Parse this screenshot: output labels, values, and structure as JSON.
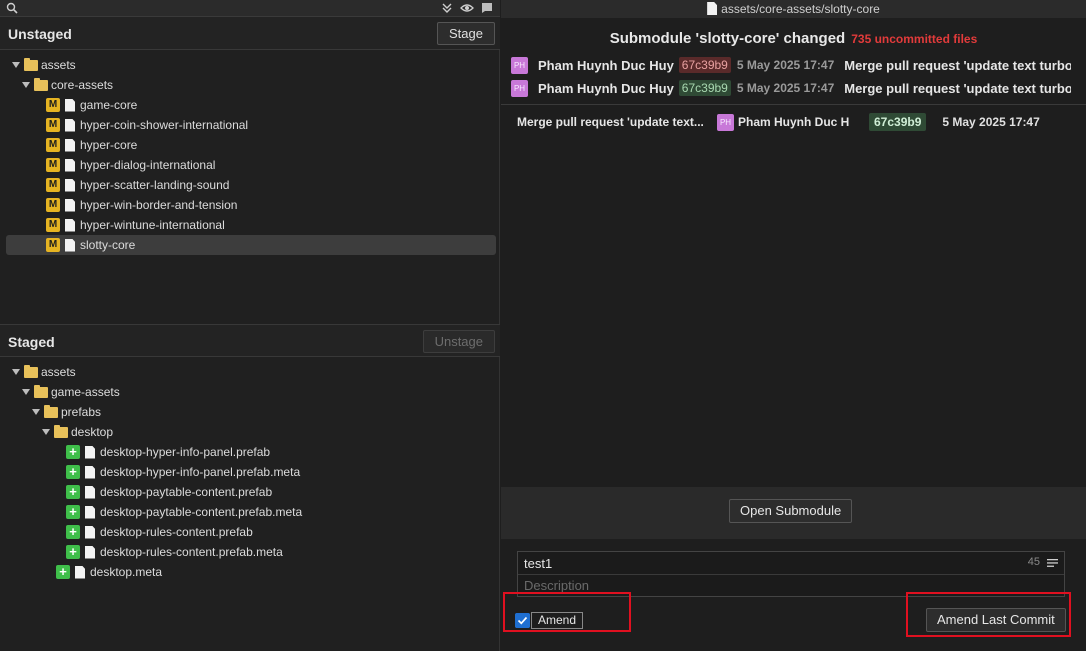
{
  "toolbar": {
    "icons": [
      "search-icon",
      "collapse-all-icon",
      "eye-icon",
      "comment-icon"
    ]
  },
  "unstaged": {
    "title": "Unstaged",
    "button": "Stage",
    "tree": [
      {
        "label": "assets",
        "kind": "folder",
        "depth": 0
      },
      {
        "label": "core-assets",
        "kind": "folder",
        "depth": 1
      },
      {
        "label": "game-core",
        "kind": "file",
        "status": "M",
        "depth": 2
      },
      {
        "label": "hyper-coin-shower-international",
        "kind": "file",
        "status": "M",
        "depth": 2
      },
      {
        "label": "hyper-core",
        "kind": "file",
        "status": "M",
        "depth": 2
      },
      {
        "label": "hyper-dialog-international",
        "kind": "file",
        "status": "M",
        "depth": 2
      },
      {
        "label": "hyper-scatter-landing-sound",
        "kind": "file",
        "status": "M",
        "depth": 2
      },
      {
        "label": "hyper-win-border-and-tension",
        "kind": "file",
        "status": "M",
        "depth": 2
      },
      {
        "label": "hyper-wintune-international",
        "kind": "file",
        "status": "M",
        "depth": 2
      },
      {
        "label": "slotty-core",
        "kind": "file",
        "status": "M",
        "depth": 2,
        "selected": true
      }
    ]
  },
  "staged": {
    "title": "Staged",
    "button": "Unstage",
    "tree": [
      {
        "label": "assets",
        "kind": "folder",
        "depth": 0
      },
      {
        "label": "game-assets",
        "kind": "folder",
        "depth": 1
      },
      {
        "label": "prefabs",
        "kind": "folder",
        "depth": 2
      },
      {
        "label": "desktop",
        "kind": "folder",
        "depth": 3
      },
      {
        "label": "desktop-hyper-info-panel.prefab",
        "kind": "file",
        "status": "+",
        "depth": 4
      },
      {
        "label": "desktop-hyper-info-panel.prefab.meta",
        "kind": "file",
        "status": "+",
        "depth": 4
      },
      {
        "label": "desktop-paytable-content.prefab",
        "kind": "file",
        "status": "+",
        "depth": 4
      },
      {
        "label": "desktop-paytable-content.prefab.meta",
        "kind": "file",
        "status": "+",
        "depth": 4
      },
      {
        "label": "desktop-rules-content.prefab",
        "kind": "file",
        "status": "+",
        "depth": 4
      },
      {
        "label": "desktop-rules-content.prefab.meta",
        "kind": "file",
        "status": "+",
        "depth": 4
      },
      {
        "label": "desktop.meta",
        "kind": "file",
        "status": "+",
        "depth": 3
      }
    ]
  },
  "diff": {
    "path": "assets/core-assets/slotty-core",
    "title": "Submodule 'slotty-core' changed",
    "uncommitted": "735 uncommitted files",
    "commits": [
      {
        "avatar": "PH",
        "author": "Pham Huynh Duc Huy",
        "sha": "67c39b9",
        "sha_style": "red",
        "date": "5 May 2025 17:47",
        "message": "Merge pull request 'update text turbo"
      },
      {
        "avatar": "PH",
        "author": "Pham Huynh Duc Huy",
        "sha": "67c39b9",
        "sha_style": "green",
        "date": "5 May 2025 17:47",
        "message": "Merge pull request 'update text turbo"
      }
    ],
    "detail": {
      "message": "Merge pull request 'update text...",
      "avatar": "PH",
      "author": "Pham Huynh Duc H",
      "sha": "67c39b9",
      "date": "5 May 2025 17:47"
    },
    "open_button": "Open Submodule"
  },
  "commit": {
    "summary": "test1",
    "char_count": "45",
    "description_placeholder": "Description",
    "amend_label": "Amend",
    "amend_checked": true,
    "amend_button": "Amend Last Commit"
  },
  "colors": {
    "modified": "#e6b422",
    "added": "#3fbf4a",
    "highlight": "#e01020",
    "accent": "#1f6fd1"
  }
}
